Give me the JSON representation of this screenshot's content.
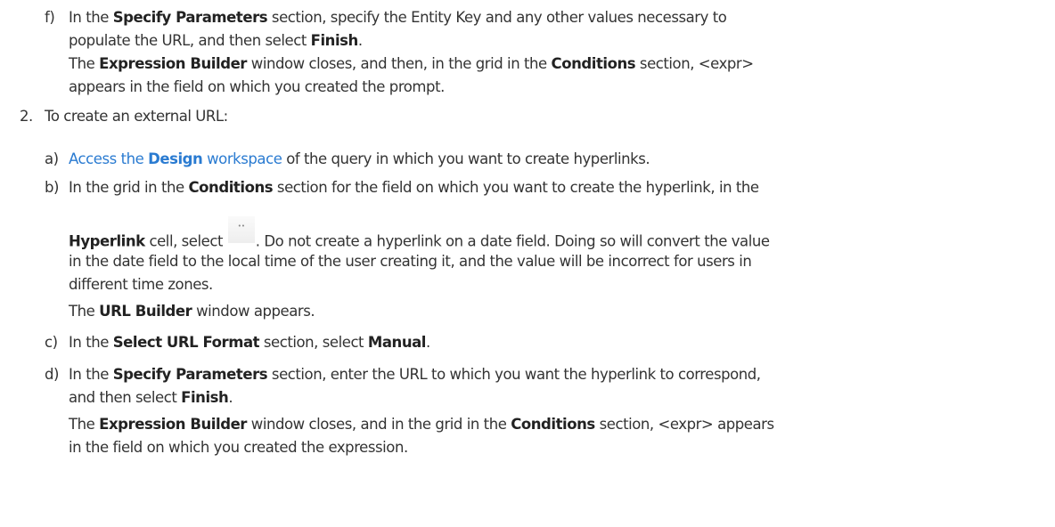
{
  "step_f": {
    "label": "f)",
    "l1a": "In the ",
    "l1b": "Specify Parameters",
    "l1c": " section, specify the Entity Key and any other values necessary to",
    "l2a": "populate the URL, and then select ",
    "l2b": "Finish",
    "l2c": ".",
    "l3a": "The ",
    "l3b": "Expression Builder",
    "l3c": " window closes, and then, in the grid in the ",
    "l3d": "Conditions",
    "l3e": " section, <expr>",
    "l4": "appears in the field on which you created the prompt."
  },
  "step2": {
    "label": "2.",
    "text": "To create an external URL:"
  },
  "step_a": {
    "label": "a)",
    "link_a": "Access the ",
    "link_b": "Design",
    "link_c": " workspace",
    "rest": " of the query in which you want to create hyperlinks."
  },
  "step_b": {
    "label": "b)",
    "l1a": "In the grid in the ",
    "l1b": "Conditions",
    "l1c": " section for the field on which you want to create the hyperlink, in the",
    "l2a": "Hyperlink",
    "l2b": " cell, select ",
    "l2c": ". Do not create a hyperlink on a date field. Doing so will convert the value",
    "l3": "in the date field to the local time of the user creating it, and the value will be incorrect for users in",
    "l4": "different time zones.",
    "l5a": "The ",
    "l5b": "URL Builder",
    "l5c": " window appears.",
    "icon": "ellipsis-button-icon"
  },
  "step_c": {
    "label": "c)",
    "a": "In the ",
    "b": "Select URL Format",
    "c": " section, select ",
    "d": "Manual",
    "e": "."
  },
  "step_d": {
    "label": "d)",
    "l1a": "In the ",
    "l1b": "Specify Parameters",
    "l1c": " section, enter the URL to which you want the hyperlink to correspond,",
    "l2a": "and then select ",
    "l2b": "Finish",
    "l2c": ".",
    "l3a": "The ",
    "l3b": "Expression Builder",
    "l3c": " window closes, and in the grid in the ",
    "l3d": "Conditions",
    "l3e": " section, <expr> appears",
    "l4": "in the field on which you created the expression."
  },
  "colors": {
    "text": "#333333",
    "link": "#2a7bd1",
    "background": "#ffffff"
  }
}
